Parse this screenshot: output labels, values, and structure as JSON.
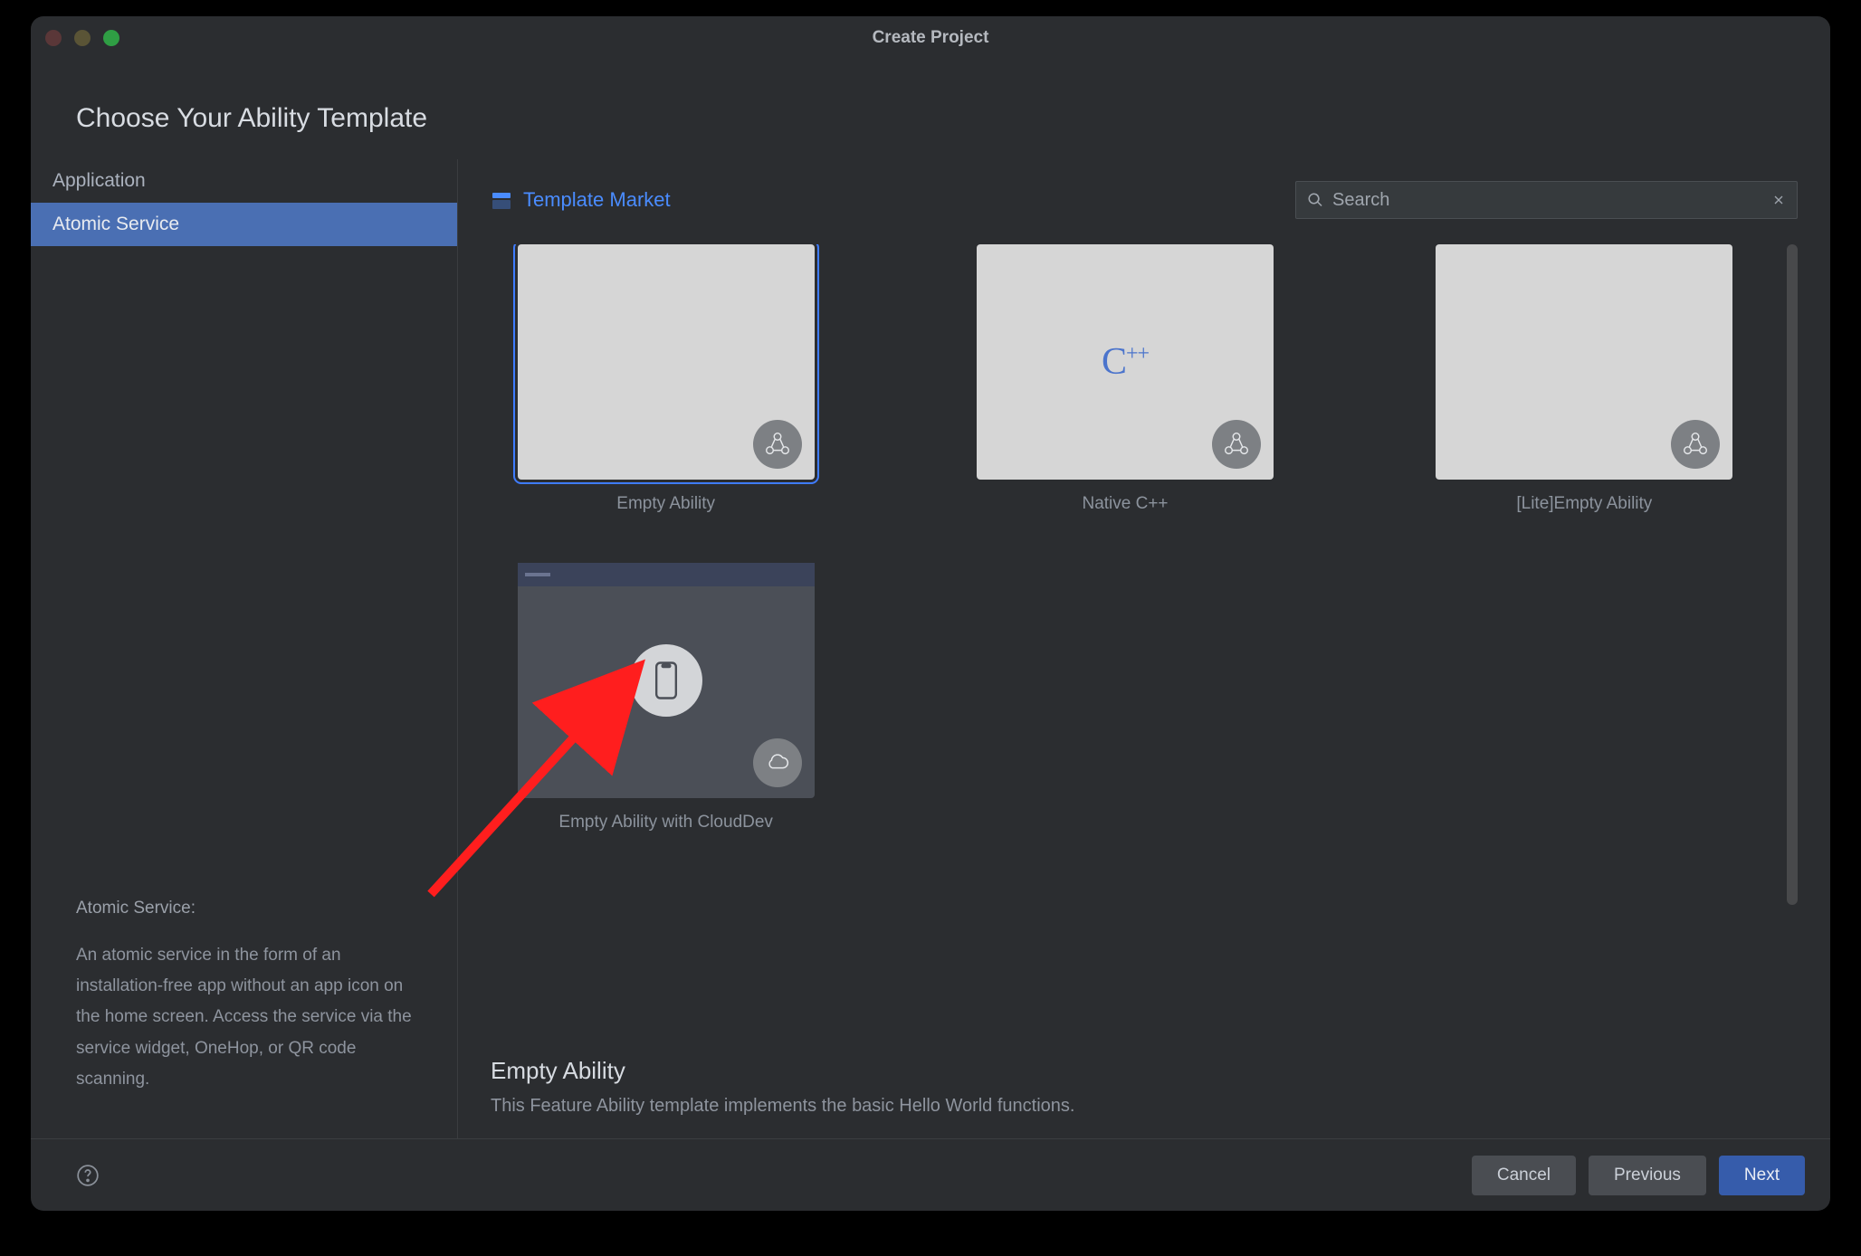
{
  "window": {
    "title": "Create Project"
  },
  "heading": "Choose Your Ability Template",
  "sidebar": {
    "items": [
      {
        "label": "Application"
      },
      {
        "label": "Atomic Service"
      }
    ],
    "desc_title": "Atomic Service:",
    "desc_body": "An atomic service in the form of an installation-free app without an app icon on the home screen. Access the service via the service widget, OneHop, or QR code scanning."
  },
  "main_header": {
    "template_market": "Template Market",
    "search_placeholder": "Search"
  },
  "templates": [
    {
      "label": "Empty Ability"
    },
    {
      "label": "Native C++"
    },
    {
      "label": "[Lite]Empty Ability"
    },
    {
      "label": "Empty Ability with CloudDev"
    }
  ],
  "selected_template": {
    "title": "Empty Ability",
    "description": "This Feature Ability template implements the basic Hello World functions."
  },
  "footer": {
    "cancel": "Cancel",
    "previous": "Previous",
    "next": "Next"
  }
}
